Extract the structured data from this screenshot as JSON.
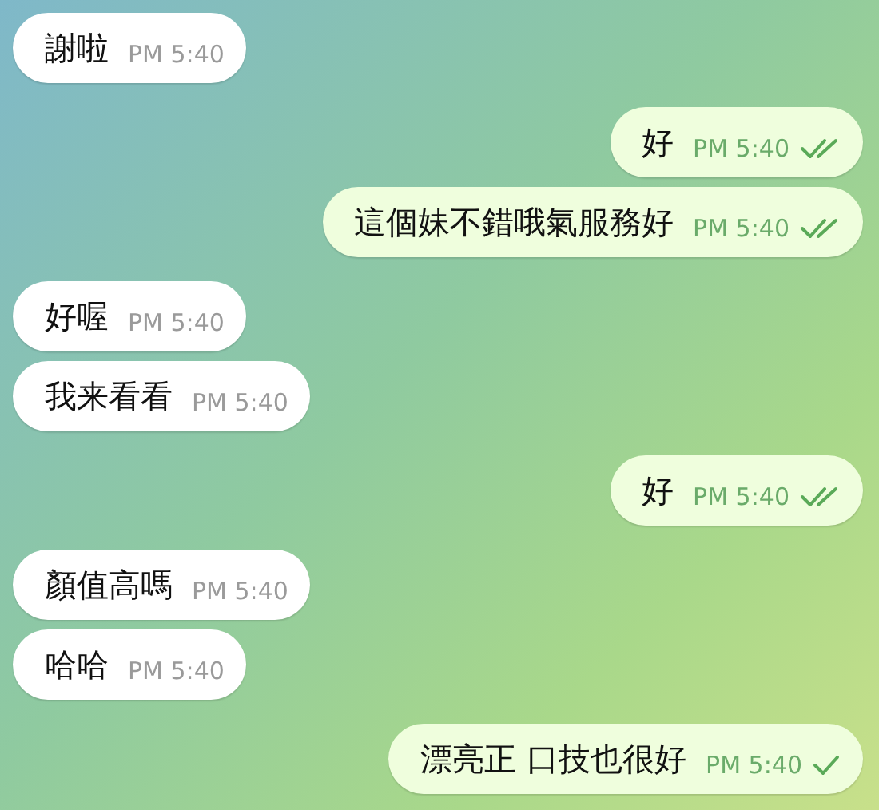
{
  "messages": [
    {
      "kind": "incoming",
      "text": "謝啦",
      "time": "PM 5:40"
    },
    {
      "kind": "outgoing",
      "text": "好",
      "time": "PM 5:40",
      "read": true
    },
    {
      "kind": "outgoing",
      "text": "這個妹不錯哦氣服務好",
      "time": "PM 5:40",
      "read": true
    },
    {
      "kind": "incoming",
      "text": "好喔",
      "time": "PM 5:40"
    },
    {
      "kind": "incoming",
      "text": "我来看看",
      "time": "PM 5:40"
    },
    {
      "kind": "outgoing",
      "text": "好",
      "time": "PM 5:40",
      "read": true
    },
    {
      "kind": "incoming",
      "text": "顏值高嗎",
      "time": "PM 5:40"
    },
    {
      "kind": "incoming",
      "text": "哈哈",
      "time": "PM 5:40"
    },
    {
      "kind": "outgoing",
      "text": "漂亮正 口技也很好",
      "time": "PM 5:40",
      "read": false
    }
  ]
}
